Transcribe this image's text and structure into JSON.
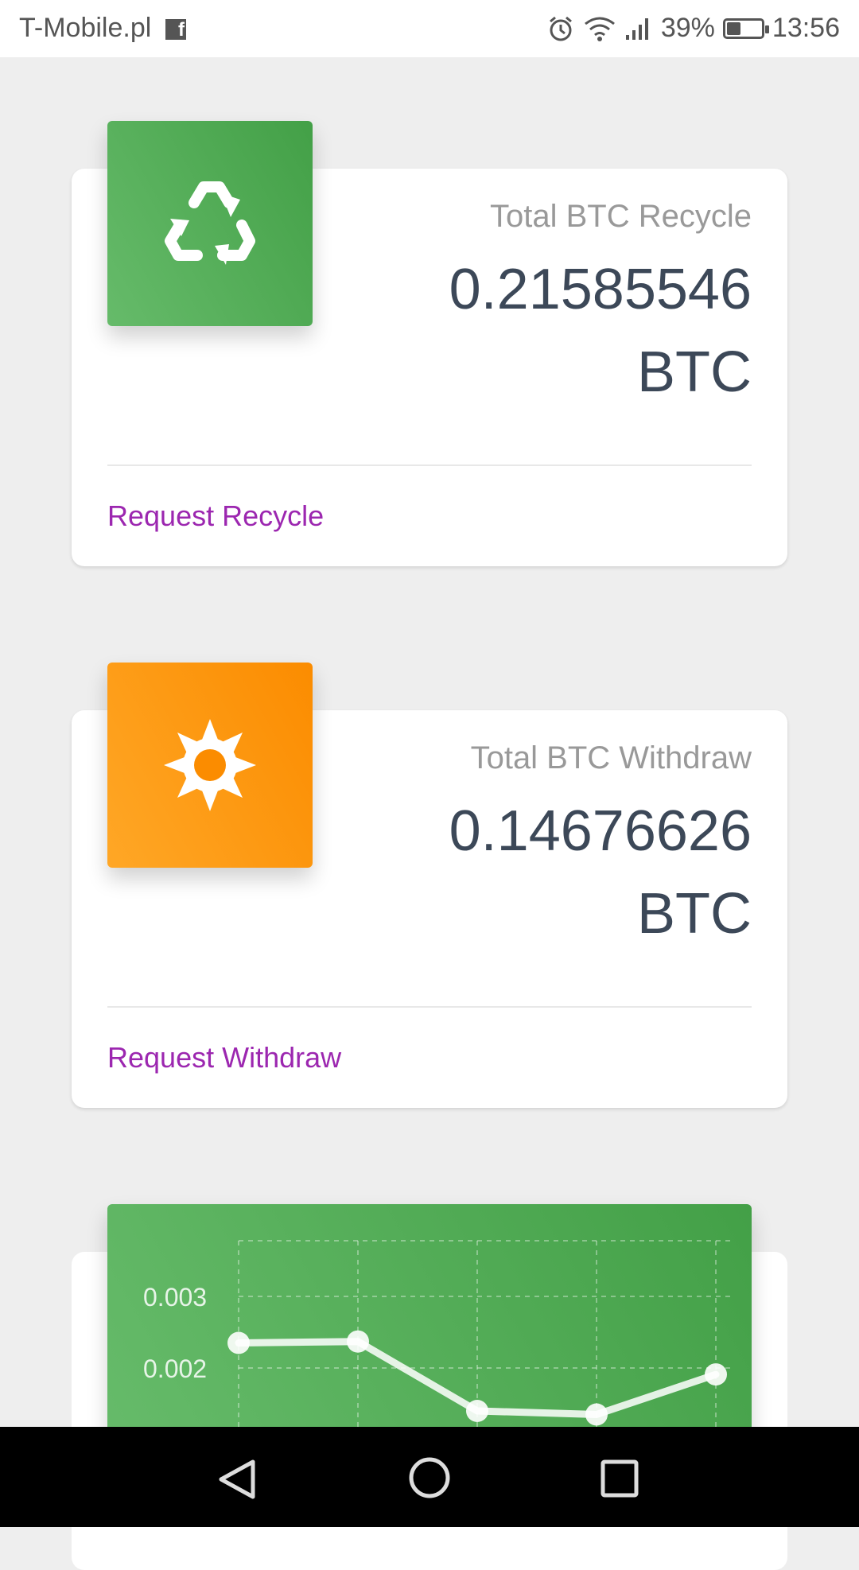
{
  "status_bar": {
    "carrier": "T-Mobile.pl",
    "notification_icon": "facebook-icon",
    "battery_percent": "39%",
    "battery_level": 0.39,
    "time": "13:56"
  },
  "cards": [
    {
      "icon": "recycle-icon",
      "title": "Total BTC Recycle",
      "value": "0.21585546",
      "unit": "BTC",
      "link": "Request Recycle",
      "color": "#4caf50"
    },
    {
      "icon": "sun-icon",
      "title": "Total BTC Withdraw",
      "value": "0.14676626",
      "unit": "BTC",
      "link": "Request Withdraw",
      "color": "#ff9800"
    }
  ],
  "chart_data": {
    "type": "line",
    "y_ticks": [
      "0.003",
      "0.002"
    ],
    "series": [
      {
        "values": [
          0.00235,
          0.00237,
          0.0014,
          0.00135,
          0.00191
        ]
      }
    ]
  },
  "nav": {
    "back": "back-icon",
    "home": "home-icon",
    "recents": "recents-icon"
  },
  "colors": {
    "accent_green": "#4caf50",
    "accent_orange": "#ff9800",
    "link_purple": "#9c27b0",
    "value_text": "#3c4858"
  }
}
